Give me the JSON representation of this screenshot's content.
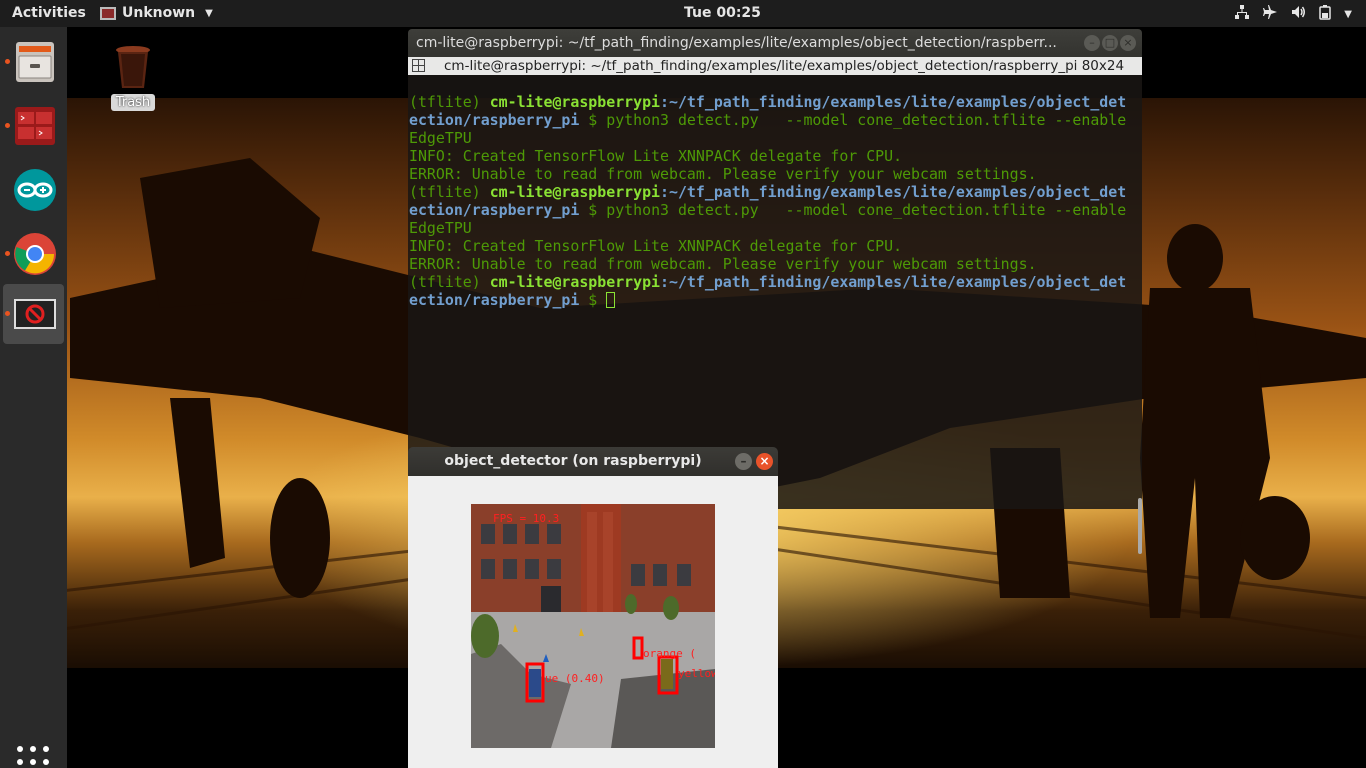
{
  "topbar": {
    "activities": "Activities",
    "app_name": "Unknown",
    "clock": "Tue 00:25",
    "tray_icons": [
      "network-icon",
      "airplane-mode-icon",
      "volume-icon",
      "battery-icon",
      "power-menu-chevron-icon"
    ]
  },
  "dock": {
    "items": [
      {
        "name": "files",
        "icon": "file-cabinet-icon",
        "running": true
      },
      {
        "name": "terminal-app",
        "icon": "red-terminal-icon",
        "running": true
      },
      {
        "name": "arduino",
        "icon": "arduino-icon",
        "running": false
      },
      {
        "name": "chrome",
        "icon": "chrome-icon",
        "running": true
      },
      {
        "name": "unknown-app",
        "icon": "no-entry-window-icon",
        "running": true,
        "active": true
      }
    ],
    "show_apps_icon": "apps-grid-icon"
  },
  "desktop": {
    "trash_label": "Trash"
  },
  "terminal": {
    "title": "cm-lite@raspberrypi: ~/tf_path_finding/examples/lite/examples/object_detection/raspberr...",
    "tab_label": "cm-lite@raspberrypi: ~/tf_path_finding/examples/lite/examples/object_detection/raspberry_pi 80x24",
    "lines": {
      "l1_env": "(tflite) ",
      "l1_user": "cm-lite@raspberrypi",
      "l1_path": ":~/tf_path_finding/examples/lite/examples/object_det",
      "l2_path": "ection/raspberry_pi",
      "l2_cmd": " $ python3 detect.py   --model cone_detection.tflite --enable",
      "l3": "EdgeTPU",
      "l4": "INFO: Created TensorFlow Lite XNNPACK delegate for CPU.",
      "l5": "ERROR: Unable to read from webcam. Please verify your webcam settings.",
      "l6_env": "(tflite) ",
      "l6_user": "cm-lite@raspberrypi",
      "l6_path": ":~/tf_path_finding/examples/lite/examples/object_det",
      "l7_path": "ection/raspberry_pi",
      "l7_cmd": " $ python3 detect.py   --model cone_detection.tflite --enable",
      "l8": "EdgeTPU",
      "l9": "INFO: Created TensorFlow Lite XNNPACK delegate for CPU.",
      "l10": "ERROR: Unable to read from webcam. Please verify your webcam settings.",
      "l11_env": "(tflite) ",
      "l11_user": "cm-lite@raspberrypi",
      "l11_path": ":~/tf_path_finding/examples/lite/examples/object_det",
      "l12_path": "ection/raspberry_pi",
      "l12_cmd": " $ "
    }
  },
  "detector_window": {
    "title": "object_detector (on raspberrypi)",
    "overlay": {
      "fps": "FPS = 10.3",
      "label_blue": "ue (0.40)",
      "label_orange": "orange (",
      "label_right": "yellow"
    },
    "colors": {
      "box": "#ff0000",
      "text": "#ff2020"
    }
  }
}
